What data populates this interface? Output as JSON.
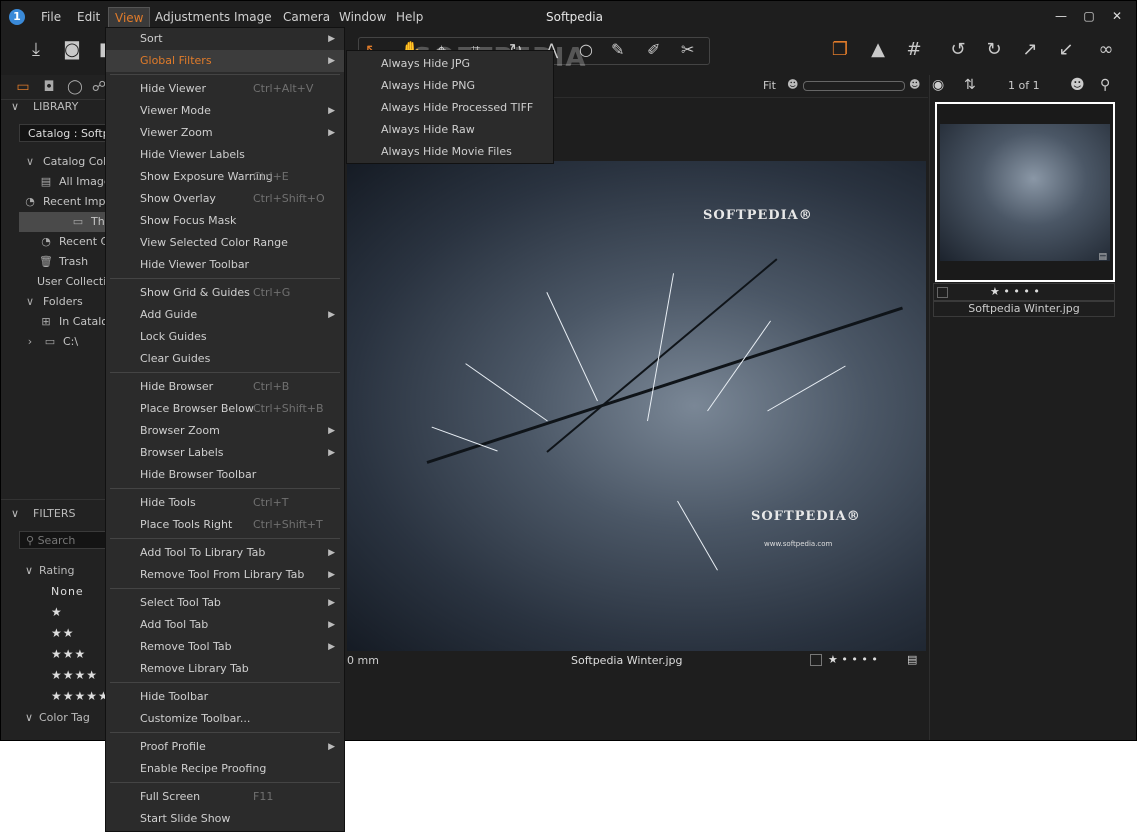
{
  "window": {
    "title": "Softpedia",
    "menu": [
      "File",
      "Edit",
      "View",
      "Adjustments",
      "Image",
      "Camera",
      "Window",
      "Help"
    ],
    "active_menu": "View",
    "controls": {
      "minimize": "—",
      "maximize": "▢",
      "close": "✕"
    }
  },
  "left_panel": {
    "library_header": "LIBRARY",
    "catalog_value": "Catalog : Softpedia",
    "tree": [
      {
        "label": "Catalog Collections",
        "icon": "chevron-down-icon"
      },
      {
        "label": "All Images",
        "icon": "images-icon"
      },
      {
        "label": "Recent Imports",
        "icon": "clock-icon"
      },
      {
        "label": "Thursday",
        "icon": "folder-icon",
        "selected": true
      },
      {
        "label": "Recent Captures",
        "icon": "clock-icon"
      },
      {
        "label": "Trash",
        "icon": "trash-icon"
      },
      {
        "label": "User Collections",
        "icon": ""
      },
      {
        "label": "Folders",
        "icon": "chevron-down-icon"
      },
      {
        "label": "In Catalog",
        "icon": "book-icon"
      },
      {
        "label": "C:\\",
        "icon": "drive-icon"
      }
    ],
    "filters_header": "FILTERS",
    "search_placeholder": "Search",
    "rating_header": "Rating",
    "rating_none": "None",
    "ratings": [
      "★",
      "★★",
      "★★★",
      "★★★★",
      "★★★★★"
    ],
    "color_tag_header": "Color Tag"
  },
  "viewer": {
    "fit_label": "Fit",
    "filename": "Softpedia Winter.jpg",
    "measure": "0 mm",
    "watermark_top": "SOFTPEDIA®",
    "watermark_bottom": "SOFTPEDIA®",
    "watermark_url": "www.softpedia.com",
    "rating_dots": "★ • • • •"
  },
  "browser": {
    "counter": "1 of 1",
    "thumb_name": "Softpedia Winter.jpg",
    "thumb_rating": "★ • • • •"
  },
  "toolbar_watermark": "SOFTPEDIA",
  "view_menu": {
    "items": [
      {
        "label": "Sort",
        "shortcut": "",
        "submenu": true
      },
      {
        "label": "Global Filters",
        "shortcut": "",
        "submenu": true,
        "highlighted": true
      },
      {
        "sep": true
      },
      {
        "label": "Hide Viewer",
        "shortcut": "Ctrl+Alt+V",
        "submenu": false
      },
      {
        "label": "Viewer Mode",
        "shortcut": "",
        "submenu": true
      },
      {
        "label": "Viewer Zoom",
        "shortcut": "",
        "submenu": true
      },
      {
        "label": "Hide Viewer Labels",
        "shortcut": "",
        "submenu": false
      },
      {
        "label": "Show Exposure Warning",
        "shortcut": "Ctrl+E",
        "submenu": false
      },
      {
        "label": "Show Overlay",
        "shortcut": "Ctrl+Shift+O",
        "submenu": false
      },
      {
        "label": "Show Focus Mask",
        "shortcut": "",
        "submenu": false
      },
      {
        "label": "View Selected Color Range",
        "shortcut": "",
        "submenu": false
      },
      {
        "label": "Hide Viewer Toolbar",
        "shortcut": "",
        "submenu": false
      },
      {
        "sep": true
      },
      {
        "label": "Show Grid & Guides",
        "shortcut": "Ctrl+G",
        "submenu": false
      },
      {
        "label": "Add Guide",
        "shortcut": "",
        "submenu": true
      },
      {
        "label": "Lock Guides",
        "shortcut": "",
        "submenu": false
      },
      {
        "label": "Clear Guides",
        "shortcut": "",
        "submenu": false
      },
      {
        "sep": true
      },
      {
        "label": "Hide Browser",
        "shortcut": "Ctrl+B",
        "submenu": false
      },
      {
        "label": "Place Browser Below",
        "shortcut": "Ctrl+Shift+B",
        "submenu": false
      },
      {
        "label": "Browser Zoom",
        "shortcut": "",
        "submenu": true
      },
      {
        "label": "Browser Labels",
        "shortcut": "",
        "submenu": true
      },
      {
        "label": "Hide Browser Toolbar",
        "shortcut": "",
        "submenu": false
      },
      {
        "sep": true
      },
      {
        "label": "Hide Tools",
        "shortcut": "Ctrl+T",
        "submenu": false
      },
      {
        "label": "Place Tools Right",
        "shortcut": "Ctrl+Shift+T",
        "submenu": false
      },
      {
        "sep": true
      },
      {
        "label": "Add Tool To Library Tab",
        "shortcut": "",
        "submenu": true
      },
      {
        "label": "Remove Tool From Library Tab",
        "shortcut": "",
        "submenu": true
      },
      {
        "sep": true
      },
      {
        "label": "Select Tool Tab",
        "shortcut": "",
        "submenu": true
      },
      {
        "label": "Add Tool Tab",
        "shortcut": "",
        "submenu": true
      },
      {
        "label": "Remove Tool Tab",
        "shortcut": "",
        "submenu": true
      },
      {
        "label": "Remove Library Tab",
        "shortcut": "",
        "submenu": false
      },
      {
        "sep": true
      },
      {
        "label": "Hide Toolbar",
        "shortcut": "",
        "submenu": false
      },
      {
        "label": "Customize Toolbar...",
        "shortcut": "",
        "submenu": false
      },
      {
        "sep": true
      },
      {
        "label": "Proof Profile",
        "shortcut": "",
        "submenu": true
      },
      {
        "label": "Enable Recipe Proofing",
        "shortcut": "",
        "submenu": false
      },
      {
        "sep": true
      },
      {
        "label": "Full Screen",
        "shortcut": "F11",
        "submenu": false
      },
      {
        "label": "Start Slide Show",
        "shortcut": "",
        "submenu": false
      }
    ]
  },
  "global_filters_submenu": [
    "Always Hide JPG",
    "Always Hide PNG",
    "Always Hide Processed TIFF",
    "Always Hide Raw",
    "Always Hide Movie Files"
  ],
  "colors": {
    "accent": "#e07b2a",
    "background": "#1e1e1e",
    "menu_bg": "#2b2b2b"
  }
}
